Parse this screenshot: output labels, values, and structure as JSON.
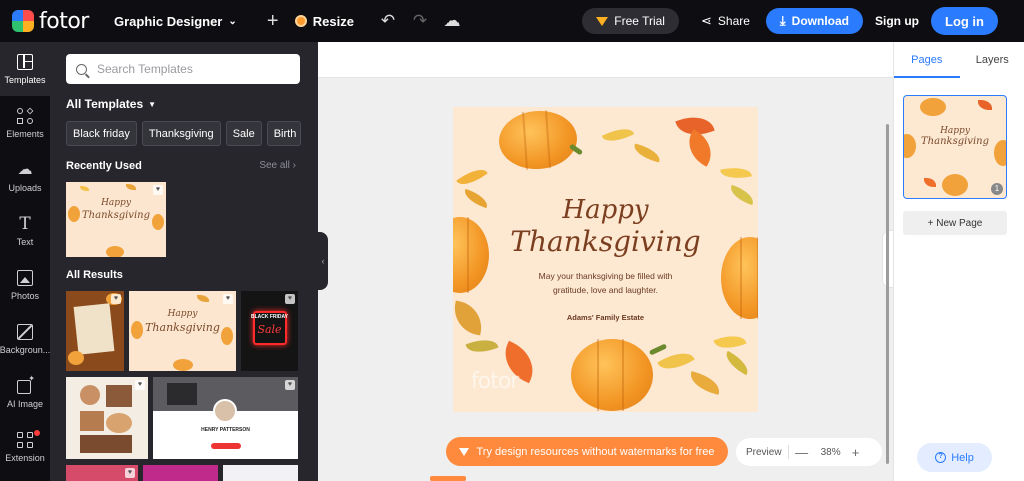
{
  "header": {
    "logo_text": "fotor",
    "project_name": "Graphic Designer",
    "resize_label": "Resize",
    "free_trial_label": "Free Trial",
    "share_label": "Share",
    "download_label": "Download",
    "signup_label": "Sign up",
    "login_label": "Log in"
  },
  "rail": {
    "items": [
      {
        "label": "Templates",
        "icon": "templates-icon"
      },
      {
        "label": "Elements",
        "icon": "elements-icon"
      },
      {
        "label": "Uploads",
        "icon": "upload-cloud-icon"
      },
      {
        "label": "Text",
        "icon": "text-icon"
      },
      {
        "label": "Photos",
        "icon": "photos-icon"
      },
      {
        "label": "Backgroun...",
        "icon": "background-icon"
      },
      {
        "label": "AI Image",
        "icon": "ai-image-icon"
      },
      {
        "label": "Extension",
        "icon": "extension-icon"
      }
    ]
  },
  "panel": {
    "search_placeholder": "Search Templates",
    "all_templates_label": "All Templates",
    "chips": [
      "Black friday",
      "Thanksgiving",
      "Sale",
      "Birth"
    ],
    "recently_used_label": "Recently Used",
    "see_all_label": "See all",
    "all_results_label": "All Results",
    "thumb_texts": {
      "happy": "Happy",
      "thanksgiving": "Thanksgiving",
      "black_friday": "BLACK FRIDAY",
      "sale": "Sale",
      "henry": "HENRY PATTERSON"
    }
  },
  "canvas": {
    "title_line1": "Happy",
    "title_line2": "Thanksgiving",
    "body_line1": "May your thanksgiving be filled with",
    "body_line2": "gratitude, love and laughter.",
    "signature": "Adams' Family Estate",
    "watermark": "fotor"
  },
  "bottom": {
    "promo_label": "Try design resources without watermarks for free",
    "preview_label": "Preview",
    "zoom_value": "38%",
    "zoom_minus": "—",
    "zoom_plus": "+"
  },
  "right_panel": {
    "tabs": [
      "Pages",
      "Layers"
    ],
    "page_number": "1",
    "new_page_label": "+ New Page",
    "help_label": "Help"
  },
  "colors": {
    "topbar_bg": "#0e0e12",
    "panel_bg": "#26262c",
    "accent_blue": "#2b7bff",
    "promo_orange": "#ff8a3d",
    "card_bg": "#fde8d2",
    "pumpkin": "#f29524",
    "title_brown": "#7b3e1f"
  }
}
